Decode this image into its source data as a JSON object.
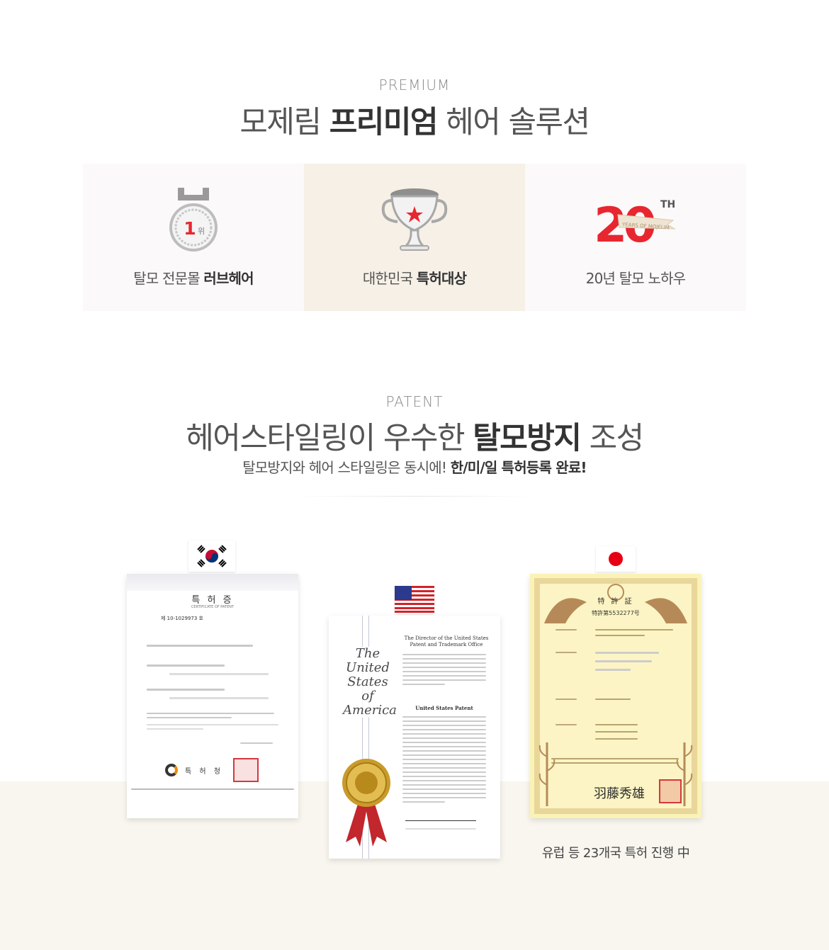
{
  "premium": {
    "eyebrow": "PREMIUM",
    "title_pre": "모제림 ",
    "title_bold": "프리미엄",
    "title_post": " 헤어 솔루션"
  },
  "features": [
    {
      "icon": "medal-icon",
      "badge": "1",
      "badge_suffix": "위",
      "label_pre": "탈모 전문몰 ",
      "label_bold": "러브헤어"
    },
    {
      "icon": "trophy-icon",
      "label_pre": "대한민국 ",
      "label_bold": "특허대상"
    },
    {
      "icon": "anniversary-20th-icon",
      "badge": "20",
      "badge_sup": "TH",
      "ribbon": "YEARS OF MOJELIM",
      "label_pre": "20년 탈모 노하우",
      "label_bold": ""
    }
  ],
  "patent": {
    "eyebrow": "PATENT",
    "title_pre": "헤어스타일링이 우수한 ",
    "title_bold": "탈모방지",
    "title_post": " 조성",
    "sub_pre": "탈모방지와 헤어 스타일링은 동시에! ",
    "sub_bold": "한/미/일 특허등록 완료!"
  },
  "certificates": {
    "korea": {
      "flag": "korea-flag-icon",
      "title": "특 허 증",
      "subtitle": "CERTIFICATE OF PATENT",
      "number": "제 10-1029973 호",
      "office": "특 허 청"
    },
    "usa": {
      "flag": "usa-flag-icon",
      "script_title": [
        "The",
        "United",
        "States",
        "of",
        "America"
      ],
      "heading": "The Director of the United States Patent and Trademark Office",
      "patent_heading": "United States Patent"
    },
    "japan": {
      "flag": "japan-flag-icon",
      "title": "特 許 証",
      "number": "特許第5532277号",
      "signature": "羽藤秀雄"
    }
  },
  "footnote": "유럽 등 23개국 특허 진행 中",
  "colors": {
    "accent_red": "#e8262f",
    "highlight_bg": "#f6f0e7",
    "band_bg": "#f9f6ef"
  }
}
